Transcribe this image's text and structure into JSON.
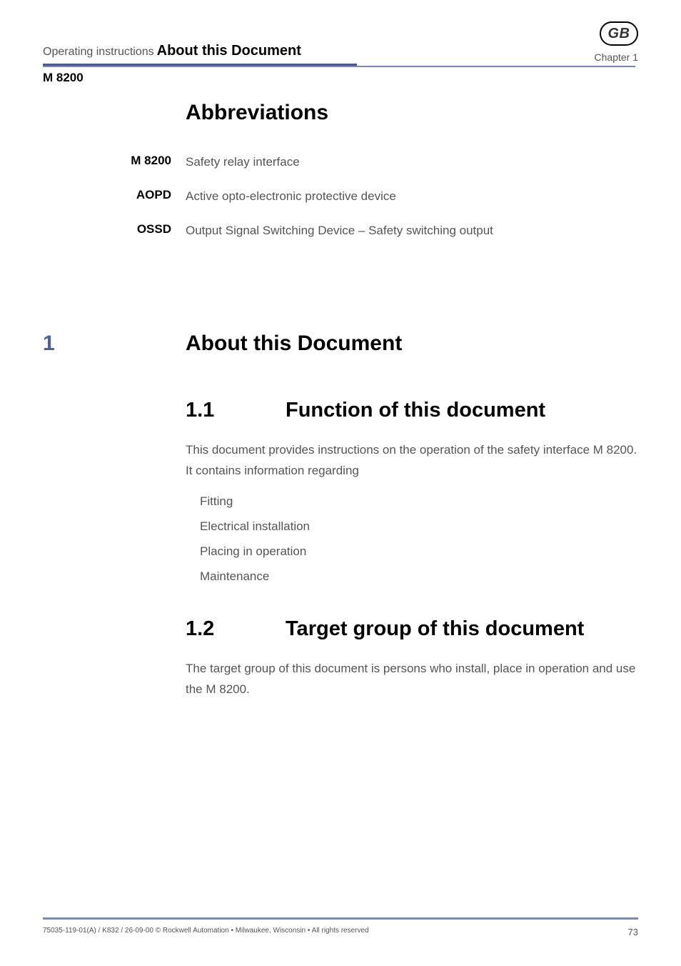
{
  "header": {
    "label": "Operating instructions",
    "title": "About this Document",
    "badge": "GB",
    "chapter": "Chapter 1",
    "model": "M 8200"
  },
  "abbreviations": {
    "title": "Abbreviations",
    "items": [
      {
        "key": "M 8200",
        "value": "Safety relay interface"
      },
      {
        "key": "AOPD",
        "value": "Active opto-electronic protective device"
      },
      {
        "key": "OSSD",
        "value": "Output Signal Switching Device – Safety switching output"
      }
    ]
  },
  "chapter": {
    "number": "1",
    "title": "About this Document"
  },
  "section1": {
    "number": "1.1",
    "title": "Function of this document",
    "body": "This document provides instructions on the operation of the safety interface M 8200. It contains information regarding",
    "list": [
      "Fitting",
      "Electrical installation",
      "Placing in operation",
      "Maintenance"
    ]
  },
  "section2": {
    "number": "1.2",
    "title": "Target group of this document",
    "body": "The target group of this document is persons who install, place in operation and use the M 8200."
  },
  "footer": {
    "left": "75035-119-01(A) / K832 / 26-09-00  © Rockwell Automation • Milwaukee, Wisconsin • All rights reserved",
    "page": "73"
  }
}
